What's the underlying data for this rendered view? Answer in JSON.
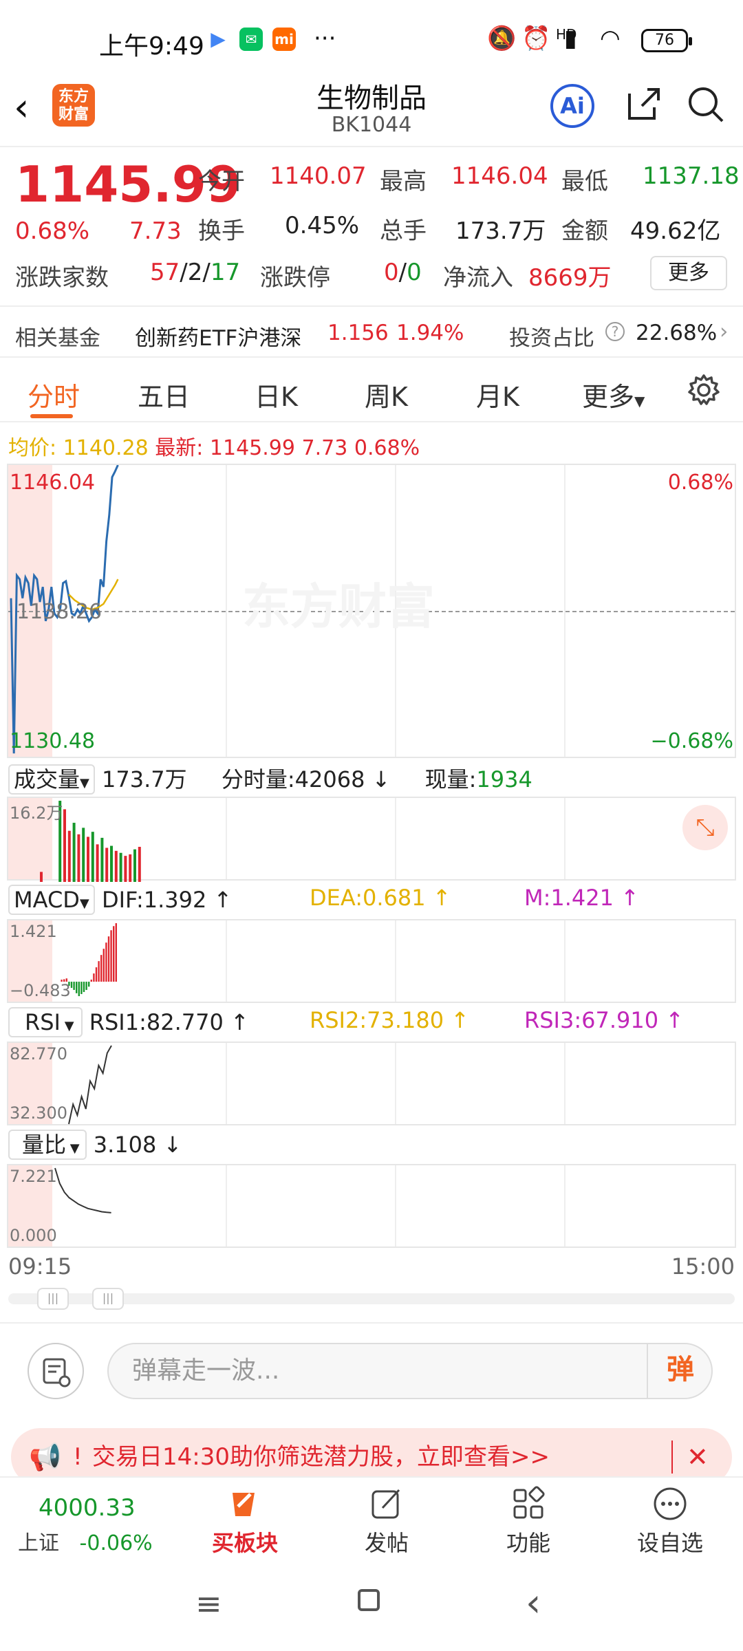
{
  "status_bar": {
    "time": "上午9:49",
    "battery": "76",
    "signal_label": "HD"
  },
  "header": {
    "title": "生物制品",
    "code": "BK1044",
    "logo_text": "东方\n财富",
    "ai_label": "Ai"
  },
  "quote": {
    "price": "1145.99",
    "change_pct": "0.68%",
    "change": "7.73",
    "open_label": "今开",
    "open": "1140.07",
    "high_label": "最高",
    "high": "1146.04",
    "low_label": "最低",
    "low": "1137.18",
    "turnover_label": "换手",
    "turnover": "0.45%",
    "volume_label": "总手",
    "volume": "173.7万",
    "amount_label": "金额",
    "amount": "49.62亿",
    "breadth_label": "涨跌家数",
    "breadth_up": "57",
    "breadth_flat": "2",
    "breadth_down": "17",
    "limit_label": "涨跌停",
    "limit_up": "0",
    "limit_down": "0",
    "inflow_label": "净流入",
    "inflow": "8669万",
    "more_label": "更多"
  },
  "fund": {
    "label": "相关基金",
    "name": "创新药ETF沪港深",
    "price": "1.156",
    "pct": "1.94%",
    "ratio_label": "投资占比",
    "ratio": "22.68%"
  },
  "tabs": [
    "分时",
    "五日",
    "日K",
    "周K",
    "月K",
    "更多"
  ],
  "chart_header": {
    "avg_label": "均价:",
    "avg": "1140.28",
    "last_label": "最新:",
    "last": "1145.99",
    "chg": "7.73",
    "pct": "0.68%"
  },
  "chart_data": [
    {
      "type": "line",
      "title": "",
      "y_high": "1146.04",
      "y_low": "1130.48",
      "y_mid": "1138.26",
      "pct_high": "0.68%",
      "pct_low": "−0.68%",
      "ylim": [
        1130.48,
        1146.04
      ],
      "xlim": [
        0,
        240
      ],
      "x": [
        0,
        1,
        2,
        3,
        4,
        5,
        6,
        7,
        8,
        9,
        10,
        11,
        12,
        13,
        14,
        15,
        16,
        17,
        18,
        19,
        20,
        21,
        22,
        23,
        24,
        25,
        26,
        27,
        28,
        29,
        30,
        31,
        32,
        33,
        34,
        35,
        36,
        37
      ],
      "series": [
        {
          "key": "price",
          "values": [
            1139.0,
            1130.8,
            1140.2,
            1140.0,
            1139.0,
            1140.1,
            1139.8,
            1138.6,
            1140.2,
            1140.0,
            1138.8,
            1139.6,
            1137.8,
            1138.4,
            1139.6,
            1138.2,
            1138.0,
            1138.4,
            1139.8,
            1139.9,
            1139.1,
            1138.2,
            1138.1,
            1138.4,
            1138.2,
            1138.6,
            1138.2,
            1137.8,
            1138.0,
            1138.4,
            1138.2,
            1140.0,
            1139.6,
            1142.0,
            1143.4,
            1145.4,
            1145.7,
            1146.04
          ]
        },
        {
          "key": "avg",
          "x": [
            20,
            22,
            24,
            26,
            28,
            30,
            32,
            34,
            36,
            37
          ],
          "values": [
            1139.2,
            1138.9,
            1138.7,
            1138.5,
            1138.4,
            1138.5,
            1138.7,
            1139.2,
            1139.7,
            1140.0
          ]
        }
      ]
    },
    {
      "type": "bar",
      "title": "成交量",
      "ymax_label": "16.2万",
      "ylim": [
        0,
        16.2
      ],
      "values": [
        2.0,
        0,
        0,
        0,
        16.2,
        14.5,
        10.2,
        11.8,
        9.5,
        10.8,
        9.0,
        10.0,
        7.5,
        8.8,
        6.8,
        7.2,
        6.2,
        5.8,
        5.2,
        5.5,
        6.5,
        7.0
      ],
      "colors": [
        "red",
        "red",
        "red",
        "red",
        "green",
        "red",
        "red",
        "green",
        "red",
        "green",
        "red",
        "green",
        "red",
        "green",
        "red",
        "green",
        "red",
        "green",
        "red",
        "red",
        "green",
        "red"
      ]
    },
    {
      "type": "bar",
      "title": "MACD",
      "ymax_label": "1.421",
      "ymin_label": "−0.483",
      "ylim": [
        -0.483,
        1.421
      ],
      "values": [
        0,
        0,
        0,
        0,
        0.05,
        0.06,
        0.08,
        -0.1,
        -0.15,
        -0.2,
        -0.28,
        -0.35,
        -0.3,
        -0.25,
        -0.2,
        -0.12,
        0.05,
        0.2,
        0.35,
        0.5,
        0.65,
        0.8,
        0.95,
        1.1,
        1.25,
        1.35,
        1.421
      ]
    },
    {
      "type": "line",
      "title": "RSI",
      "ymax_label": "82.770",
      "ymin_label": "32.300",
      "ylim": [
        32.3,
        82.77
      ],
      "values": [
        32.3,
        45,
        38,
        50,
        42,
        60,
        55,
        70,
        65,
        78,
        82.77
      ]
    },
    {
      "type": "line",
      "title": "量比",
      "ymax_label": "7.221",
      "ymin_label": "0.000",
      "ylim": [
        0,
        7.221
      ],
      "values": [
        7.221,
        5.8,
        5.0,
        4.5,
        4.2,
        3.9,
        3.7,
        3.5,
        3.4,
        3.3,
        3.2,
        3.15,
        3.108
      ]
    }
  ],
  "volume_row": {
    "selector": "成交量",
    "total": "173.7万",
    "tick_label": "分时量:",
    "tick": "42068",
    "now_label": "现量:",
    "now": "1934"
  },
  "macd_row": {
    "selector": "MACD",
    "dif": "DIF:1.392",
    "dea": "DEA:0.681",
    "m": "M:1.421"
  },
  "rsi_row": {
    "selector": "RSI",
    "rsi1": "RSI1:82.770",
    "rsi2": "RSI2:73.180",
    "rsi3": "RSI3:67.910"
  },
  "lb_row": {
    "selector": "量比",
    "value": "3.108"
  },
  "time_axis": {
    "start": "09:15",
    "end": "15:00"
  },
  "danmu": {
    "placeholder": "弹幕走一波...",
    "button": "弹"
  },
  "banner": {
    "text": "交易日14:30助你筛选潜力股，立即查看>>"
  },
  "bottom_nav": {
    "index_value": "4000.33",
    "index_name": "上证",
    "index_pct": "-0.06%",
    "items": [
      "买板块",
      "发帖",
      "功能",
      "设自选"
    ]
  },
  "colors": {
    "up": "#e0262f",
    "down": "#16972b",
    "accent": "#f26522",
    "line": "#2b6cb0",
    "avg": "#e3b100"
  }
}
